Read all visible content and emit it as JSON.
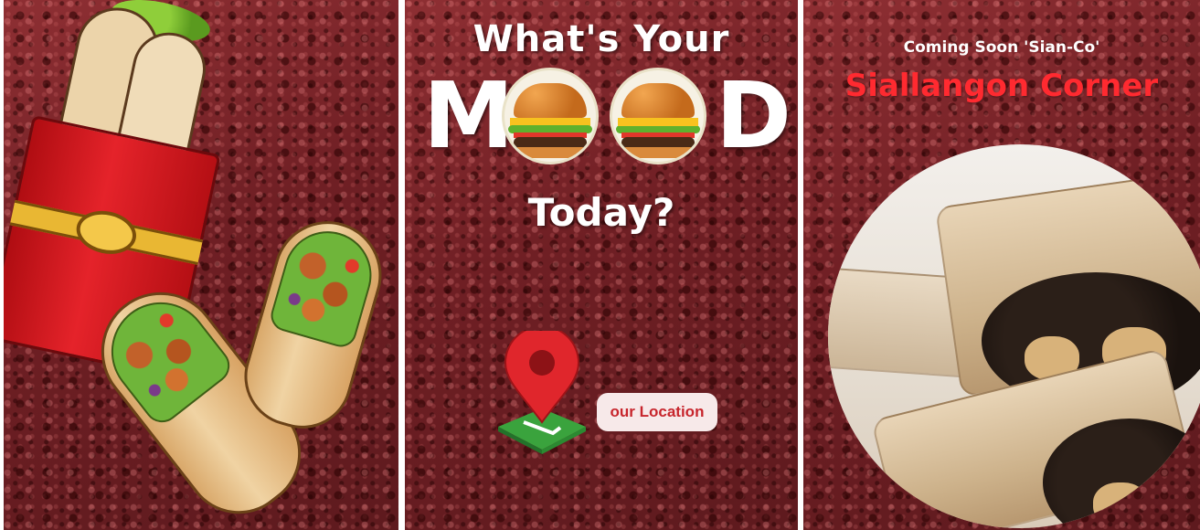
{
  "panel_left": {
    "icons": [
      "wrap-box-illustration",
      "burrito-illustration"
    ]
  },
  "panel_middle": {
    "line1": "What's Your",
    "mood_first": "M",
    "mood_last": "D",
    "line3": "Today?",
    "location_button": "our Location",
    "icons": [
      "burger-icon",
      "burger-icon",
      "map-pin-icon"
    ]
  },
  "panel_right": {
    "coming_soon": "Coming Soon 'Sian-Co'",
    "brand_name": "Siallangon Corner",
    "icons": [
      "burrito-photo"
    ]
  },
  "colors": {
    "background_texture": "#6f1f24",
    "brand_red": "#ff2a30",
    "text_white": "#ffffff",
    "button_bg": "#f7e9e9",
    "button_text": "#c7252c"
  }
}
